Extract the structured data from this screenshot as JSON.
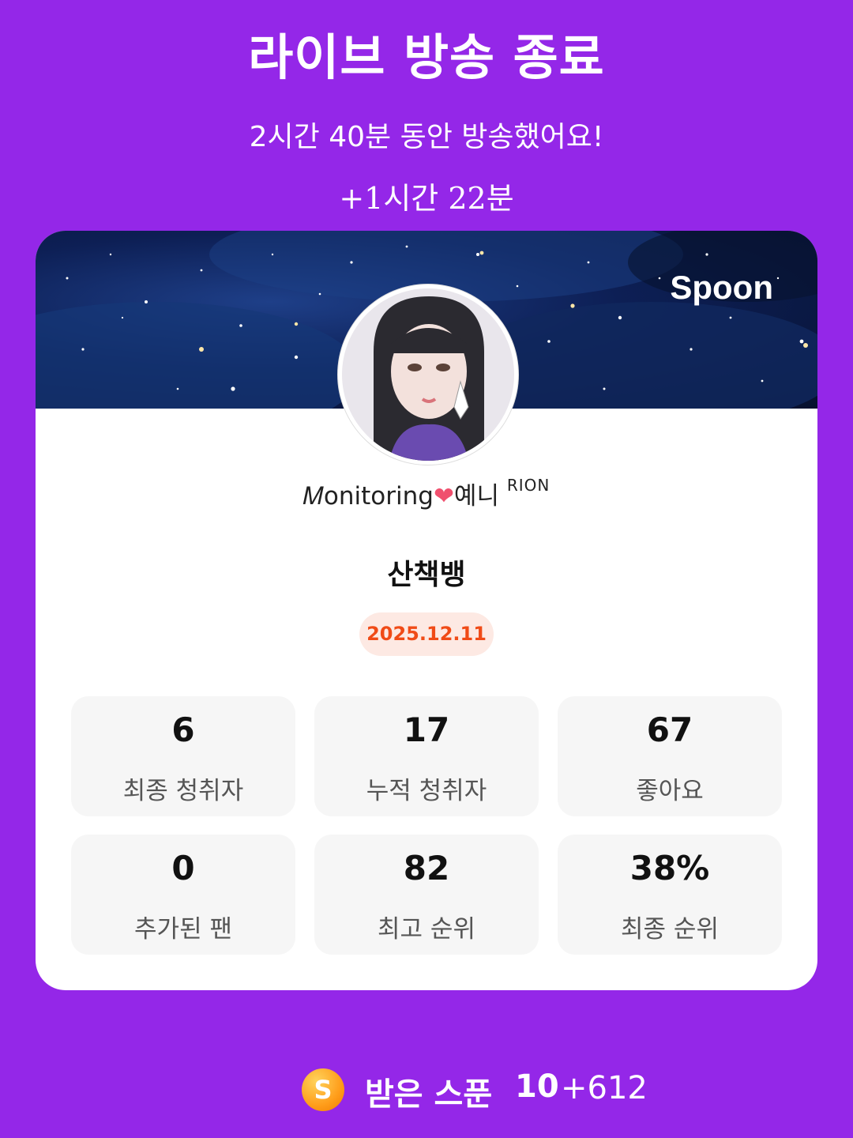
{
  "header": {
    "title": "라이브 방송 종료",
    "subtitle": "2시간 40분 동안 방송했어요!",
    "extra_time": "+1시간 22분"
  },
  "card": {
    "brand": "Spoon",
    "nickname": {
      "prefix": "𝑀onitoring",
      "heart": "❤",
      "name": "예니",
      "tag": "RION"
    },
    "room_title": "산책뱅",
    "date": "2025.12.11",
    "stats": [
      {
        "value": "6",
        "label": "최종 청취자"
      },
      {
        "value": "17",
        "label": "누적 청취자"
      },
      {
        "value": "67",
        "label": "좋아요"
      },
      {
        "value": "0",
        "label": "추가된 팬"
      },
      {
        "value": "82",
        "label": "최고 순위"
      },
      {
        "value": "38%",
        "label": "최종 순위"
      }
    ]
  },
  "footer": {
    "coin_symbol": "S",
    "received_label": "받은 스푼",
    "received_count": "10",
    "received_extra": "+612"
  },
  "colors": {
    "background": "#9427e8",
    "date_text": "#f04b17",
    "date_bg": "#fde9e3",
    "stat_bg": "#f6f6f6"
  }
}
